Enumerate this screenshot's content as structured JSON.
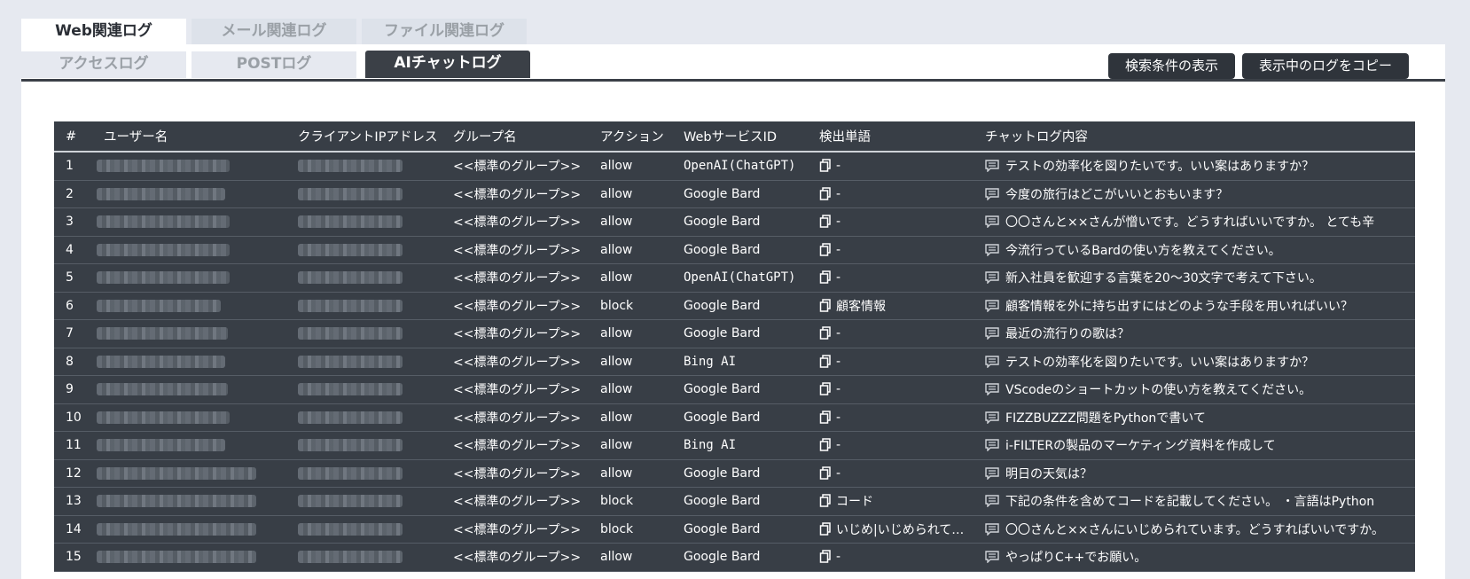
{
  "tabs_primary": [
    {
      "label": "Web関連ログ",
      "active": true
    },
    {
      "label": "メール関連ログ",
      "active": false
    },
    {
      "label": "ファイル関連ログ",
      "active": false
    }
  ],
  "tabs_secondary": [
    {
      "label": "アクセスログ",
      "active": false
    },
    {
      "label": "POSTログ",
      "active": false
    },
    {
      "label": "AIチャットログ",
      "active": true
    }
  ],
  "toolbar": {
    "show_conditions_label": "検索条件の表示",
    "copy_log_label": "表示中のログをコピー"
  },
  "table": {
    "headers": {
      "num": "#",
      "user": "ユーザー名",
      "ip": "クライアントIPアドレス",
      "group": "グループ名",
      "action": "アクション",
      "service": "WebサービスID",
      "word": "検出単語",
      "chat": "チャットログ内容"
    },
    "rows": [
      {
        "num": "1",
        "group": "<<標準のグループ>>",
        "action": "allow",
        "service": "OpenAI(ChatGPT)",
        "word": "-",
        "chat": "テストの効率化を図りたいです。いい案はありますか？"
      },
      {
        "num": "2",
        "group": "<<標準のグループ>>",
        "action": "allow",
        "service": "Google Bard",
        "word": "-",
        "chat": "今度の旅行はどこがいいとおもいます？"
      },
      {
        "num": "3",
        "group": "<<標準のグループ>>",
        "action": "allow",
        "service": "Google Bard",
        "word": "-",
        "chat": "〇〇さんと××さんが憎いです。どうすればいいですか。 とても辛"
      },
      {
        "num": "4",
        "group": "<<標準のグループ>>",
        "action": "allow",
        "service": "Google Bard",
        "word": "-",
        "chat": "今流行っているBardの使い方を教えてください。"
      },
      {
        "num": "5",
        "group": "<<標準のグループ>>",
        "action": "allow",
        "service": "OpenAI(ChatGPT)",
        "word": "-",
        "chat": "新入社員を歓迎する言葉を20～30文字で考えて下さい。"
      },
      {
        "num": "6",
        "group": "<<標準のグループ>>",
        "action": "block",
        "service": "Google Bard",
        "word": "顧客情報",
        "chat": "顧客情報を外に持ち出すにはどのような手段を用いればいい？"
      },
      {
        "num": "7",
        "group": "<<標準のグループ>>",
        "action": "allow",
        "service": "Google Bard",
        "word": "-",
        "chat": "最近の流行りの歌は？"
      },
      {
        "num": "8",
        "group": "<<標準のグループ>>",
        "action": "allow",
        "service": "Bing AI",
        "word": "-",
        "chat": "テストの効率化を図りたいです。いい案はありますか？"
      },
      {
        "num": "9",
        "group": "<<標準のグループ>>",
        "action": "allow",
        "service": "Google Bard",
        "word": "-",
        "chat": "VScodeのショートカットの使い方を教えてください。"
      },
      {
        "num": "10",
        "group": "<<標準のグループ>>",
        "action": "allow",
        "service": "Google Bard",
        "word": "-",
        "chat": "FIZZBUZZZ問題をPythonで書いて"
      },
      {
        "num": "11",
        "group": "<<標準のグループ>>",
        "action": "allow",
        "service": "Bing AI",
        "word": "-",
        "chat": "i-FILTERの製品のマーケティング資料を作成して"
      },
      {
        "num": "12",
        "group": "<<標準のグループ>>",
        "action": "allow",
        "service": "Google Bard",
        "word": "-",
        "chat": "明日の天気は？"
      },
      {
        "num": "13",
        "group": "<<標準のグループ>>",
        "action": "block",
        "service": "Google Bard",
        "word": "コード",
        "chat": "下記の条件を含めてコードを記載してください。 ・言語はPython"
      },
      {
        "num": "14",
        "group": "<<標準のグループ>>",
        "action": "block",
        "service": "Google Bard",
        "word": "いじめ|いじめられて…",
        "chat": "〇〇さんと××さんにいじめられています。どうすればいいですか。"
      },
      {
        "num": "15",
        "group": "<<標準のグループ>>",
        "action": "allow",
        "service": "Google Bard",
        "word": "-",
        "chat": "やっぱりC++でお願い。"
      }
    ]
  },
  "icons": {
    "copy": "copy-icon",
    "chat": "chat-bubble-icon"
  },
  "colors": {
    "table_bg": "#383e46",
    "active_tab": "#3b4047",
    "button_bg": "#2f343b",
    "page_bg": "#e6e9f0"
  }
}
